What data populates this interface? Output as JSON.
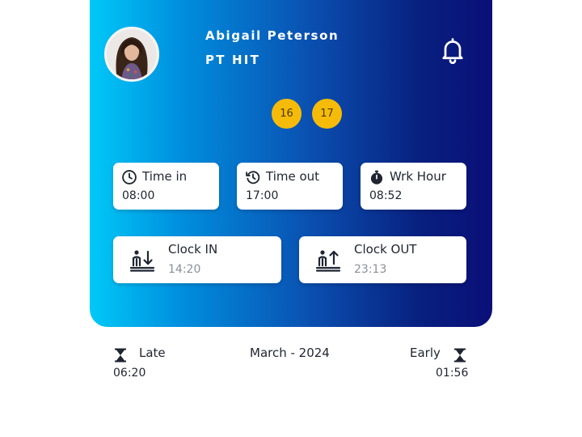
{
  "user": {
    "name": "Abigail Peterson",
    "company": "PT HIT"
  },
  "icons": {
    "notification": "bell-icon",
    "time_in": "clock-icon",
    "time_out": "history-icon",
    "work_hour": "stopwatch-icon",
    "clock_in": "clock-in-icon",
    "clock_out": "clock-out-icon",
    "late": "hourglass-icon",
    "early": "hourglass-icon"
  },
  "days": [
    "16",
    "17"
  ],
  "schedule": {
    "time_in": {
      "label": "Time in",
      "value": "08:00"
    },
    "time_out": {
      "label": "Time out",
      "value": "17:00"
    },
    "work_hour": {
      "label": "Wrk Hour",
      "value": "08:52"
    }
  },
  "attendance": {
    "clock_in": {
      "label": "Clock IN",
      "value": "14:20"
    },
    "clock_out": {
      "label": "Clock OUT",
      "value": "23:13"
    }
  },
  "summary": {
    "late_label": "Late",
    "late_value": "06:20",
    "month": "March - 2024",
    "early_label": "Early",
    "early_value": "01:56"
  },
  "colors": {
    "gradient_start": "#00c9f7",
    "gradient_end": "#0a0f78",
    "badge": "#f6bb09",
    "card": "#ffffff"
  }
}
